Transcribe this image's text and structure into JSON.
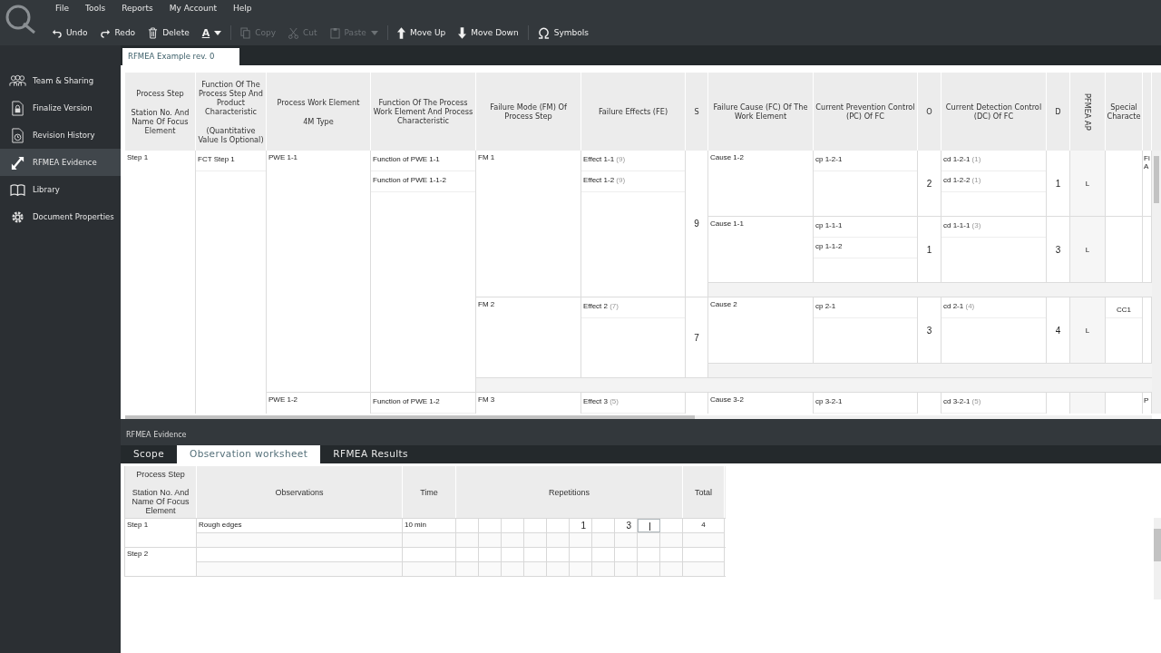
{
  "menu": [
    "File",
    "Tools",
    "Reports",
    "My Account",
    "Help"
  ],
  "toolbar": [
    [
      {
        "kind": "undo",
        "label": "Undo",
        "disabled": false
      },
      {
        "kind": "redo",
        "label": "Redo",
        "disabled": false
      },
      {
        "kind": "delete",
        "label": "Delete",
        "disabled": false
      },
      {
        "kind": "font",
        "label": "A",
        "disabled": false,
        "dropdown": true
      }
    ],
    [
      {
        "kind": "copy",
        "label": "Copy",
        "disabled": true
      },
      {
        "kind": "cut",
        "label": "Cut",
        "disabled": true
      },
      {
        "kind": "paste",
        "label": "Paste",
        "disabled": true,
        "dropdown": true
      }
    ],
    [
      {
        "kind": "up",
        "label": "Move Up",
        "disabled": false
      },
      {
        "kind": "down",
        "label": "Move Down",
        "disabled": false
      }
    ],
    [
      {
        "kind": "symbols",
        "label": "Symbols",
        "disabled": false
      }
    ]
  ],
  "sidebar": {
    "items": [
      {
        "kind": "team",
        "label": "Team & Sharing",
        "selected": false
      },
      {
        "kind": "lock",
        "label": "Finalize Version",
        "selected": false
      },
      {
        "kind": "history",
        "label": "Revision History",
        "selected": false
      },
      {
        "kind": "evidence",
        "label": "RFMEA Evidence",
        "selected": true
      },
      {
        "kind": "book",
        "label": "Library",
        "selected": false
      },
      {
        "kind": "gear",
        "label": "Document Properties",
        "selected": false
      }
    ]
  },
  "document_tabs": [
    {
      "label": "RFMEA Example rev. 0",
      "selected": true
    }
  ],
  "table": {
    "columns": [
      {
        "parts": [
          "Process Step",
          "Station No. And Name Of Focus Element"
        ]
      },
      {
        "parts": [
          "Function Of The Process Step And Product Characteristic",
          "(Quantitative Value Is Optional)"
        ]
      },
      {
        "parts": [
          "Process Work Element",
          "4M Type"
        ]
      },
      {
        "parts": [
          "Function Of The Process Work Element And Process Characteristic"
        ]
      },
      {
        "parts": [
          "Failure Mode (FM) Of Process Step"
        ]
      },
      {
        "parts": [
          "Failure Effects (FE)"
        ]
      },
      {
        "parts": [
          "S"
        ]
      },
      {
        "parts": [
          "Failure Cause (FC) Of The Work Element"
        ]
      },
      {
        "parts": [
          "Current Prevention Control (PC) Of FC"
        ]
      },
      {
        "parts": [
          "O"
        ]
      },
      {
        "parts": [
          "Current Detection Control (DC) Of FC"
        ]
      },
      {
        "parts": [
          "D"
        ]
      },
      {
        "parts": [
          "PFMEA AP"
        ],
        "vertical": true
      },
      {
        "parts": [
          "Special Characte"
        ]
      }
    ],
    "steps": [
      {
        "step": "Step 1",
        "function": "FCT Step 1",
        "work_elements": [
          {
            "name": "PWE 1-1",
            "functions": [
              "Function of PWE 1-1",
              "Function of PWE 1-1-2"
            ],
            "failure_modes": [
              {
                "name": "FM 1",
                "severity": "9",
                "effects": [
                  {
                    "text": "Effect 1-1",
                    "rating": "(9)"
                  },
                  {
                    "text": "Effect 1-2",
                    "rating": "(9)"
                  }
                ],
                "causes": [
                  {
                    "name": "Cause 1-2",
                    "prevention": [
                      "cp 1-2-1"
                    ],
                    "occurrence": "2",
                    "detection": [
                      {
                        "text": "cd 1-2-1",
                        "rating": "(1)"
                      },
                      {
                        "text": "cd 1-2-2",
                        "rating": "(1)"
                      }
                    ],
                    "d": "1",
                    "ap": "L",
                    "extra": "Fi A"
                  },
                  {
                    "name": "Cause 1-1",
                    "prevention": [
                      "cp 1-1-1",
                      "cp 1-1-2"
                    ],
                    "occurrence": "1",
                    "detection": [
                      {
                        "text": "cd 1-1-1",
                        "rating": "(3)"
                      }
                    ],
                    "d": "3",
                    "ap": "L"
                  }
                ]
              },
              {
                "name": "FM 2",
                "severity": "7",
                "effects": [
                  {
                    "text": "Effect 2",
                    "rating": "(7)"
                  }
                ],
                "causes": [
                  {
                    "name": "Cause 2",
                    "prevention": [
                      "cp 2-1"
                    ],
                    "occurrence": "3",
                    "detection": [
                      {
                        "text": "cd 2-1",
                        "rating": "(4)"
                      }
                    ],
                    "d": "4",
                    "ap": "L",
                    "special": "CC1"
                  }
                ]
              }
            ]
          },
          {
            "name": "PWE 1-2",
            "functions": [
              "Function of PWE 1-2"
            ],
            "failure_modes": [
              {
                "name": "FM 3",
                "effects": [
                  {
                    "text": "Effect 3",
                    "rating": "(5)"
                  }
                ],
                "causes": [
                  {
                    "name": "Cause 3-2",
                    "prevention": [
                      "cp 3-2-1"
                    ],
                    "detection": [
                      {
                        "text": "cd 3-2-1",
                        "rating": "(5)"
                      }
                    ],
                    "extra": "P"
                  }
                ]
              }
            ]
          }
        ]
      }
    ]
  },
  "evidence": {
    "title": "RFMEA Evidence",
    "tabs": [
      {
        "label": "Scope",
        "selected": false
      },
      {
        "label": "Observation worksheet",
        "selected": true
      },
      {
        "label": "RFMEA Results",
        "selected": false
      }
    ],
    "columns": [
      {
        "parts": [
          "Process Step",
          "Station No. And Name Of Focus Element"
        ]
      },
      {
        "parts": [
          "Observations"
        ]
      },
      {
        "parts": [
          "Time"
        ]
      },
      {
        "parts": [
          "Repetitions"
        ]
      },
      {
        "parts": [
          "Total"
        ]
      }
    ],
    "steps": [
      {
        "step": "Step 1",
        "observations": [
          {
            "text": "Rough edges",
            "time": "10 min",
            "total": "4",
            "repetitions": [
              {
                "focused": false
              },
              {
                "focused": false
              },
              {
                "focused": false
              },
              {
                "focused": false
              },
              {
                "focused": false
              },
              {
                "focused": false,
                "value": "1"
              },
              {
                "focused": false
              },
              {
                "focused": false,
                "value": "3"
              },
              {
                "focused": true
              },
              {
                "focused": false
              }
            ]
          }
        ]
      },
      {
        "step": "Step 2"
      }
    ]
  }
}
